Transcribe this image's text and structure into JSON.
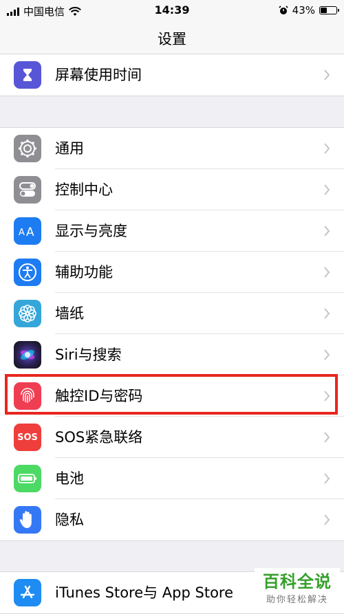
{
  "status_bar": {
    "carrier": "中国电信",
    "time": "14:39",
    "battery": "43%",
    "battery_level": 0.43
  },
  "nav": {
    "title": "设置"
  },
  "groups": [
    {
      "items": [
        {
          "label": "屏幕使用时间",
          "icon": "hourglass-icon",
          "color": "#5856d6"
        }
      ]
    },
    {
      "items": [
        {
          "label": "通用",
          "icon": "gear-icon",
          "color": "#8e8e93"
        },
        {
          "label": "控制中心",
          "icon": "toggle-switches-icon",
          "color": "#8e8e93"
        },
        {
          "label": "显示与亮度",
          "icon": "text-size-icon",
          "color": "#1e7cf2"
        },
        {
          "label": "辅助功能",
          "icon": "accessibility-icon",
          "color": "#1e7cf2"
        },
        {
          "label": "墙纸",
          "icon": "flower-icon",
          "color": "#35a6d9"
        },
        {
          "label": "Siri与搜索",
          "icon": "siri-icon",
          "color": "#1a1a2e"
        },
        {
          "label": "触控ID与密码",
          "icon": "fingerprint-icon",
          "color": "#ef3e52"
        },
        {
          "label": "SOS紧急联络",
          "icon": "sos-icon",
          "color": "#ef3e3b",
          "icon_text": "SOS"
        },
        {
          "label": "电池",
          "icon": "battery-icon",
          "color": "#4cd964"
        },
        {
          "label": "隐私",
          "icon": "hand-icon",
          "color": "#3478f6"
        }
      ]
    },
    {
      "items": [
        {
          "label": "iTunes Store与 App Store",
          "icon": "app-store-icon",
          "color": "#1e8cf2"
        }
      ]
    }
  ],
  "watermark": {
    "title": "百科全说",
    "subtitle": "助你轻松解决"
  }
}
